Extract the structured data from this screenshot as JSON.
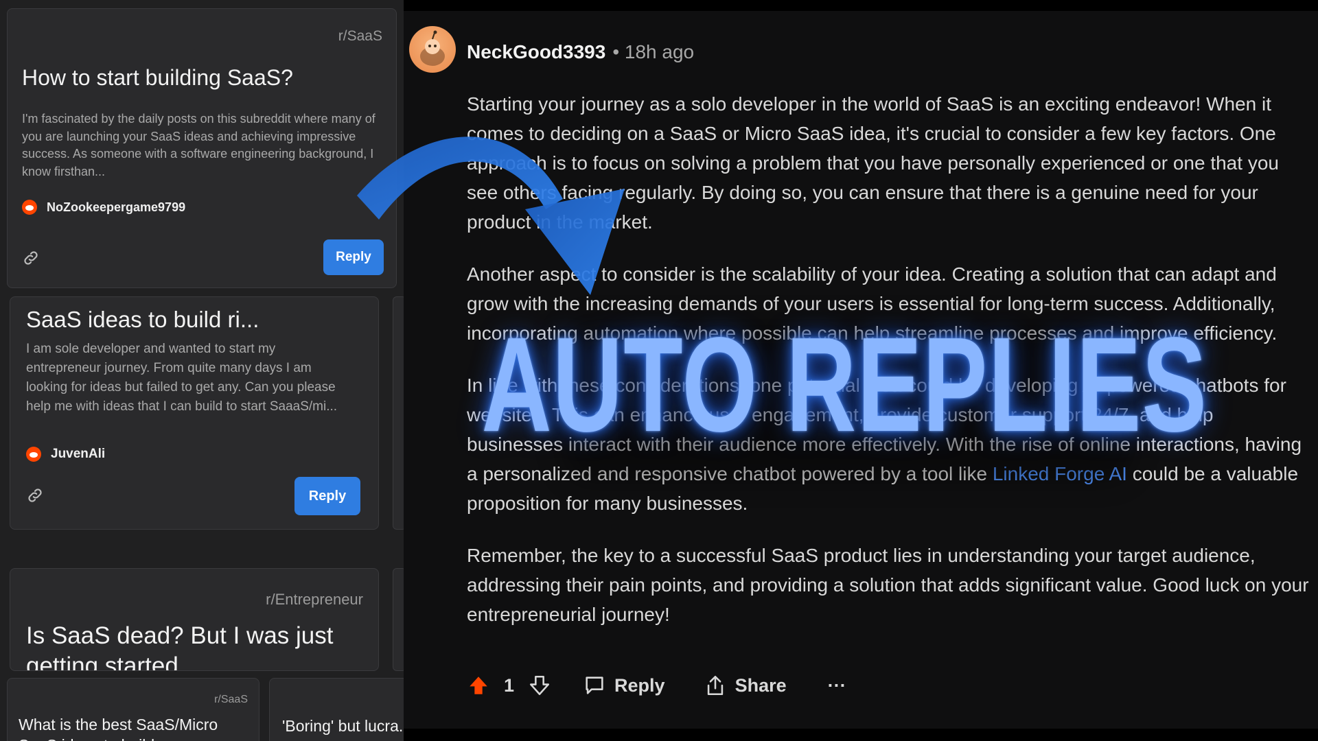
{
  "feed": {
    "cards": [
      {
        "subreddit": "r/SaaS",
        "title": "How to start building SaaS?",
        "excerpt": "I'm fascinated by the daily posts on this subreddit where many of you are launching your SaaS ideas and achieving impressive success. As someone with a software engineering background, I know firsthan...",
        "author": "NoZookeepergame9799",
        "reply_label": "Reply"
      },
      {
        "title": "SaaS ideas to build ri...",
        "excerpt": "I am sole developer and wanted to start my entrepreneur journey. From quite many days I am looking for ideas but failed to get any. Can you please help me with ideas that I can build to start SaaaS/mi...",
        "author": "JuvenAli",
        "reply_label": "Reply"
      },
      {
        "subreddit": "r/Entrepreneur",
        "title": "Is SaaS dead? But I was just getting started"
      },
      {
        "subreddit": "r/SaaS",
        "title": "What is the best SaaS/Micro SaaS ideas to build..."
      },
      {
        "title": "'Boring' but lucra..."
      }
    ]
  },
  "comment": {
    "username": "NeckGood3393",
    "time": "• 18h ago",
    "paragraphs": [
      "Starting your journey as a solo developer in the world of SaaS is an exciting endeavor! When it comes to deciding on a SaaS or Micro SaaS idea, it's crucial to consider a few key factors. One approach is to focus on solving a problem that you have personally experienced or one that you see others facing regularly. By doing so, you can ensure that there is a genuine need for your product in the market.",
      "Another aspect to consider is the scalability of your idea. Creating a solution that can adapt and grow with the increasing demands of your users is essential for long-term success. Additionally, incorporating automation where possible can help streamline processes and improve efficiency."
    ],
    "p3_before_link": "In line with these considerations, one potential idea could be developing AI-powered chatbots for websites. This can enhance user engagement, provide customer support 24/7, and help businesses interact with their audience more effectively. With the rise of online interactions, having a personalized and responsive chatbot powered by a tool like ",
    "p3_link": "Linked Forge AI",
    "p3_after_link": " could be a valuable proposition for many businesses.",
    "p4": "Remember, the key to a successful SaaS product lies in understanding your target audience, addressing their pain points, and providing a solution that adds significant value. Good luck on your entrepreneurial journey!",
    "actions": {
      "vote_count": "1",
      "reply_label": "Reply",
      "share_label": "Share",
      "more_label": "···"
    }
  },
  "overlay": {
    "headline": "AUTO REPLIES"
  },
  "colors": {
    "accent_blue": "#2f7de1",
    "upvote_orange": "#ff4500",
    "link_blue": "#4f8ff7",
    "glow_blue": "#8ab6ff"
  }
}
